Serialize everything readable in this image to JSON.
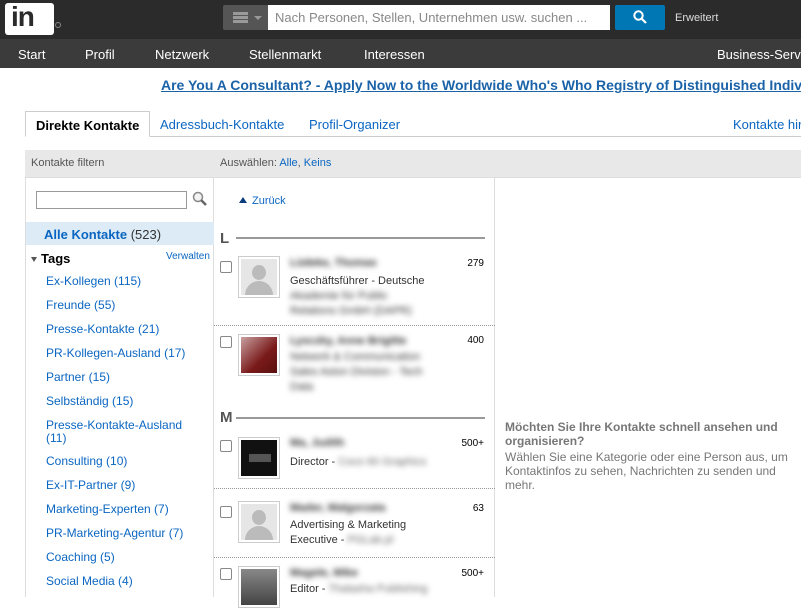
{
  "header": {
    "logo_text": "in",
    "search_placeholder": "Nach Personen, Stellen, Unternehmen usw. suchen ...",
    "advanced_label": "Erweitert"
  },
  "nav": {
    "items": [
      "Start",
      "Profil",
      "Netzwerk",
      "Stellenmarkt",
      "Interessen",
      "Business-Serv"
    ]
  },
  "ad": {
    "text": "Are You A Consultant? - Apply Now to the Worldwide Who's Who Registry of Distinguished Indiv"
  },
  "tabs": {
    "items": [
      "Direkte Kontakte",
      "Adressbuch-Kontakte",
      "Profil-Organizer",
      "Kontakte hir"
    ]
  },
  "columns": {
    "filter_header": "Kontakte filtern",
    "select_label": "Auswählen:",
    "select_all": "Alle",
    "select_none": "Keins"
  },
  "sidebar": {
    "all_contacts_label": "Alle Kontakte",
    "all_contacts_count": "(523)",
    "tags_label": "Tags",
    "manage_label": "Verwalten",
    "tags": [
      "Ex-Kollegen (115)",
      "Freunde (55)",
      "Presse-Kontakte (21)",
      "PR-Kollegen-Ausland (17)",
      "Partner (15)",
      "Selbständig (15)",
      "Presse-Kontakte-Ausland (11)",
      "Consulting (10)",
      "Ex-IT-Partner (9)",
      "Marketing-Experten (7)",
      "PR-Marketing-Agentur (7)",
      "Coaching (5)",
      "Social Media (4)"
    ]
  },
  "contacts": {
    "back_label": "Zurück",
    "groups": [
      {
        "letter": "L",
        "entries": [
          {
            "name": "Lüdeke, Thomas",
            "line1": "Geschäftsführer - Deutsche",
            "line2": "Akademie für Public",
            "line3": "Relations GmbH (DAPR)",
            "count": "279",
            "avatar": "generic-avatar"
          },
          {
            "name": "Lysczky, Anne Brigitte",
            "line1": "Network & Communication",
            "line2": "Sales Aston Division - Tech",
            "line3": "Data",
            "count": "400",
            "avatar": "photo-red"
          }
        ]
      },
      {
        "letter": "M",
        "entries": [
          {
            "name": "Ma, Judith",
            "line1": "Director - ",
            "line1_blur": "Coco 60 Graphics",
            "count": "500+",
            "avatar": "photo-dark"
          },
          {
            "name": "Mader, Malgorzata",
            "line1": "Advertising & Marketing",
            "line2": "Executive - ",
            "line2_blur": "PGLab.pl",
            "count": "63",
            "avatar": "generic-avatar"
          },
          {
            "name": "Magele, Mike",
            "line1": "Editor - ",
            "line1_blur": "Thalasha Publishing",
            "count": "500+",
            "avatar": "photo-person"
          }
        ]
      }
    ]
  },
  "detail": {
    "title": "Möchten Sie Ihre Kontakte schnell ansehen und organisieren?",
    "text": "Wählen Sie eine Kategorie oder eine Person aus, um Kontaktinfos zu sehen, Nachrichten zu senden und mehr."
  }
}
